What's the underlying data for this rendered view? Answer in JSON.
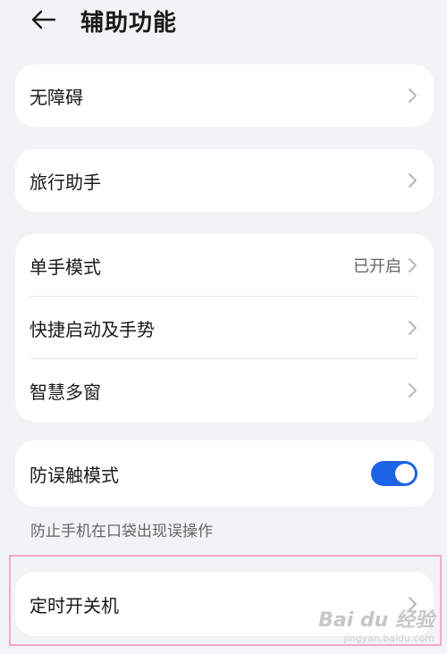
{
  "header": {
    "title": "辅助功能"
  },
  "cards": {
    "accessibility": {
      "label": "无障碍"
    },
    "travel": {
      "label": "旅行助手"
    },
    "group": {
      "one_hand": {
        "label": "单手模式",
        "value": "已开启"
      },
      "shortcut": {
        "label": "快捷启动及手势"
      },
      "multiwindow": {
        "label": "智慧多窗"
      }
    },
    "pocket": {
      "label": "防误触模式",
      "toggle_on": true
    },
    "timer": {
      "label": "定时开关机"
    }
  },
  "hint": "防止手机在口袋出现误操作",
  "watermark": {
    "main": "Bai du 经验",
    "sub": "jingyan.baidu.com"
  },
  "colors": {
    "accent": "#1e63e6",
    "highlight": "#f2aac6",
    "background": "#f1f3f5"
  }
}
